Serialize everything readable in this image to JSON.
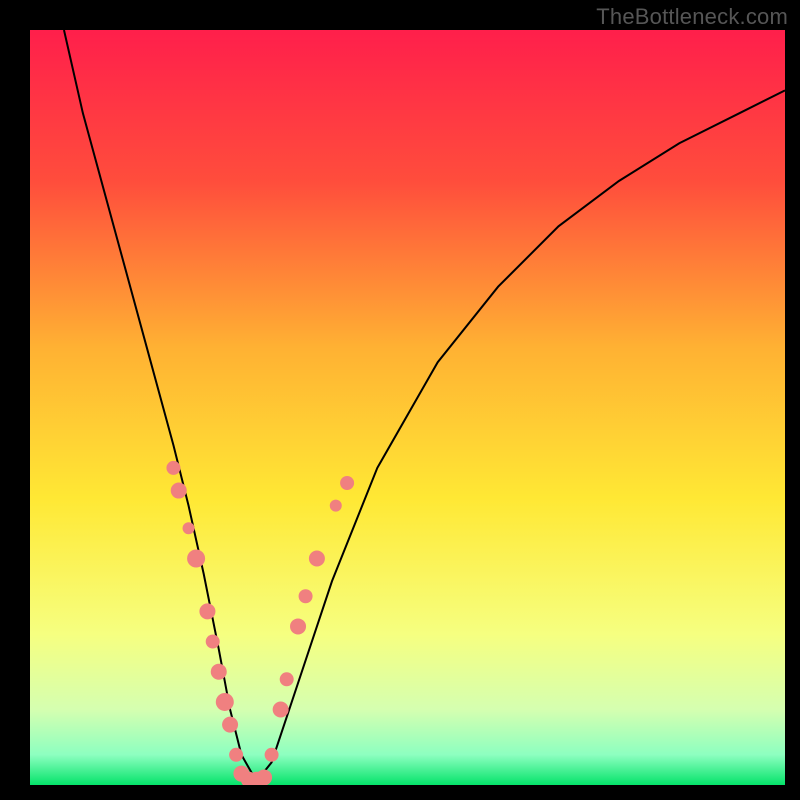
{
  "watermark": "TheBottleneck.com",
  "chart_data": {
    "type": "line",
    "title": "",
    "xlabel": "",
    "ylabel": "",
    "xlim": [
      0,
      100
    ],
    "ylim": [
      0,
      100
    ],
    "gradient_stops": [
      {
        "pct": 0,
        "color": "#ff1f4b"
      },
      {
        "pct": 20,
        "color": "#ff4d3c"
      },
      {
        "pct": 42,
        "color": "#ffb133"
      },
      {
        "pct": 62,
        "color": "#ffe834"
      },
      {
        "pct": 80,
        "color": "#f6ff80"
      },
      {
        "pct": 90,
        "color": "#d5ffb0"
      },
      {
        "pct": 96,
        "color": "#8dffc0"
      },
      {
        "pct": 100,
        "color": "#05e36a"
      }
    ],
    "series": [
      {
        "name": "bottleneck-curve",
        "x": [
          4.5,
          7,
          10,
          13,
          16,
          19,
          21,
          23,
          25,
          26.5,
          28,
          30,
          32,
          35,
          40,
          46,
          54,
          62,
          70,
          78,
          86,
          94,
          100
        ],
        "y": [
          100,
          89,
          78,
          67,
          56,
          45,
          37,
          28,
          18,
          10,
          4,
          0.5,
          3,
          12,
          27,
          42,
          56,
          66,
          74,
          80,
          85,
          89,
          92
        ]
      }
    ],
    "curve_bottom_plateau": {
      "x_start": 27.5,
      "x_end": 31,
      "y": 0.5
    },
    "scatter_points": {
      "name": "sample-points",
      "color": "#f08080",
      "points": [
        {
          "x": 19.0,
          "y": 42,
          "r": 7
        },
        {
          "x": 19.7,
          "y": 39,
          "r": 8
        },
        {
          "x": 21.0,
          "y": 34,
          "r": 6
        },
        {
          "x": 22.0,
          "y": 30,
          "r": 9
        },
        {
          "x": 23.5,
          "y": 23,
          "r": 8
        },
        {
          "x": 24.2,
          "y": 19,
          "r": 7
        },
        {
          "x": 25.0,
          "y": 15,
          "r": 8
        },
        {
          "x": 25.8,
          "y": 11,
          "r": 9
        },
        {
          "x": 26.5,
          "y": 8,
          "r": 8
        },
        {
          "x": 27.3,
          "y": 4,
          "r": 7
        },
        {
          "x": 28.0,
          "y": 1.5,
          "r": 8
        },
        {
          "x": 29.0,
          "y": 0.7,
          "r": 8
        },
        {
          "x": 30.0,
          "y": 0.7,
          "r": 8
        },
        {
          "x": 31.0,
          "y": 1.0,
          "r": 8
        },
        {
          "x": 32.0,
          "y": 4,
          "r": 7
        },
        {
          "x": 33.2,
          "y": 10,
          "r": 8
        },
        {
          "x": 34.0,
          "y": 14,
          "r": 7
        },
        {
          "x": 35.5,
          "y": 21,
          "r": 8
        },
        {
          "x": 36.5,
          "y": 25,
          "r": 7
        },
        {
          "x": 38.0,
          "y": 30,
          "r": 8
        },
        {
          "x": 40.5,
          "y": 37,
          "r": 6
        },
        {
          "x": 42.0,
          "y": 40,
          "r": 7
        }
      ]
    }
  }
}
